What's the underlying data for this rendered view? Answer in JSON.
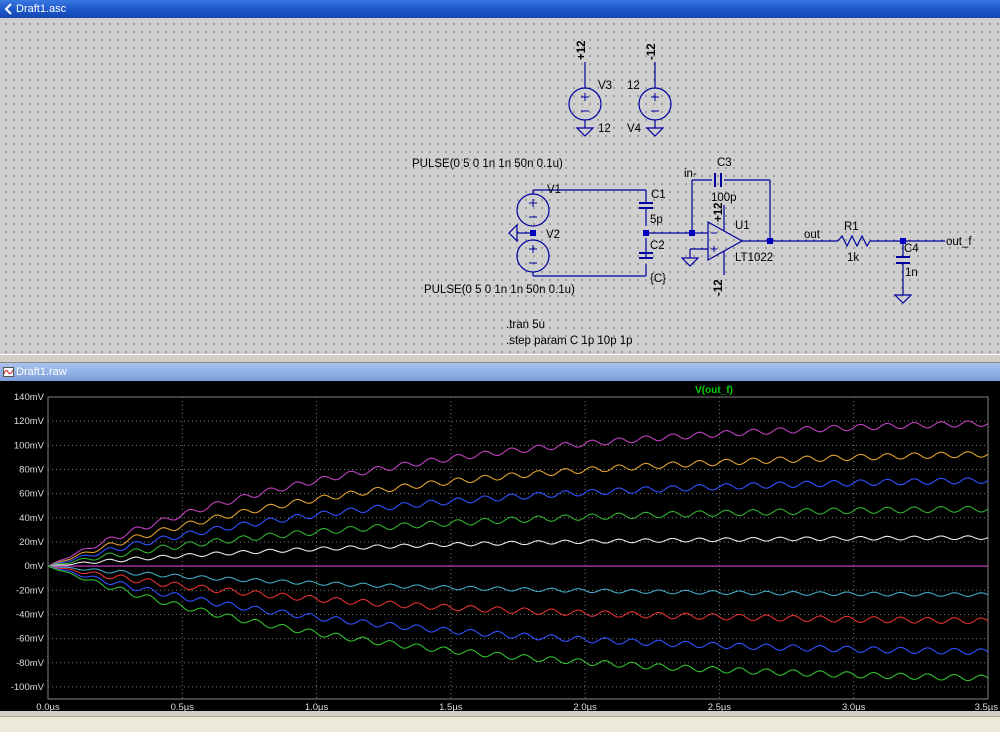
{
  "schematic_window": {
    "title": "Draft1.asc"
  },
  "waveform_window": {
    "title": "Draft1.raw"
  },
  "schematic": {
    "v3": {
      "name": "V3",
      "value": "12",
      "net": "+12"
    },
    "v4": {
      "name": "V4",
      "value": "12",
      "net": "-12"
    },
    "v1": {
      "name": "V1",
      "value": "PULSE(0 5 0 1n 1n 50n 0.1u)"
    },
    "v2": {
      "name": "V2",
      "value": "PULSE(0 5 0 1n 1n 50n 0.1u)"
    },
    "c1": {
      "name": "C1",
      "value": "5p"
    },
    "c2": {
      "name": "C2",
      "value": "{C}"
    },
    "c3": {
      "name": "C3",
      "value": "100p"
    },
    "c4": {
      "name": "C4",
      "value": "1n"
    },
    "r1": {
      "name": "R1",
      "value": "1k"
    },
    "u1": {
      "name": "U1",
      "value": "LT1022",
      "vpos": "+12",
      "vneg": "-12"
    },
    "labels": {
      "in_minus": "in-",
      "out": "out",
      "out_f": "out_f"
    },
    "directives": [
      ".tran 5u",
      ".step param C  1p 10p 1p"
    ]
  },
  "chart_data": {
    "type": "line",
    "title": "V(out_f)",
    "xlim": [
      0,
      3.5
    ],
    "ylim": [
      -110,
      140
    ],
    "x_ticks": [
      "0.0µs",
      "0.5µs",
      "1.0µs",
      "1.5µs",
      "2.0µs",
      "2.5µs",
      "3.0µs",
      "3.5µs"
    ],
    "y_ticks": [
      "140mV",
      "120mV",
      "100mV",
      "80mV",
      "60mV",
      "40mV",
      "20mV",
      "0mV",
      "-20mV",
      "-40mV",
      "-60mV",
      "-80mV",
      "-100mV"
    ],
    "grid": true,
    "series": [
      {
        "color": "#c040c0",
        "final_mV": 125
      },
      {
        "color": "#e0a030",
        "final_mV": 98
      },
      {
        "color": "#3050ff",
        "final_mV": 75
      },
      {
        "color": "#30b030",
        "final_mV": 50
      },
      {
        "color": "#e8e8e8",
        "final_mV": 25
      },
      {
        "color": "#d040d0",
        "final_mV": 0
      },
      {
        "color": "#40a8c0",
        "final_mV": -25
      },
      {
        "color": "#e03030",
        "final_mV": -48
      },
      {
        "color": "#3050ff",
        "final_mV": -75
      },
      {
        "color": "#30c030",
        "final_mV": -98
      }
    ]
  }
}
